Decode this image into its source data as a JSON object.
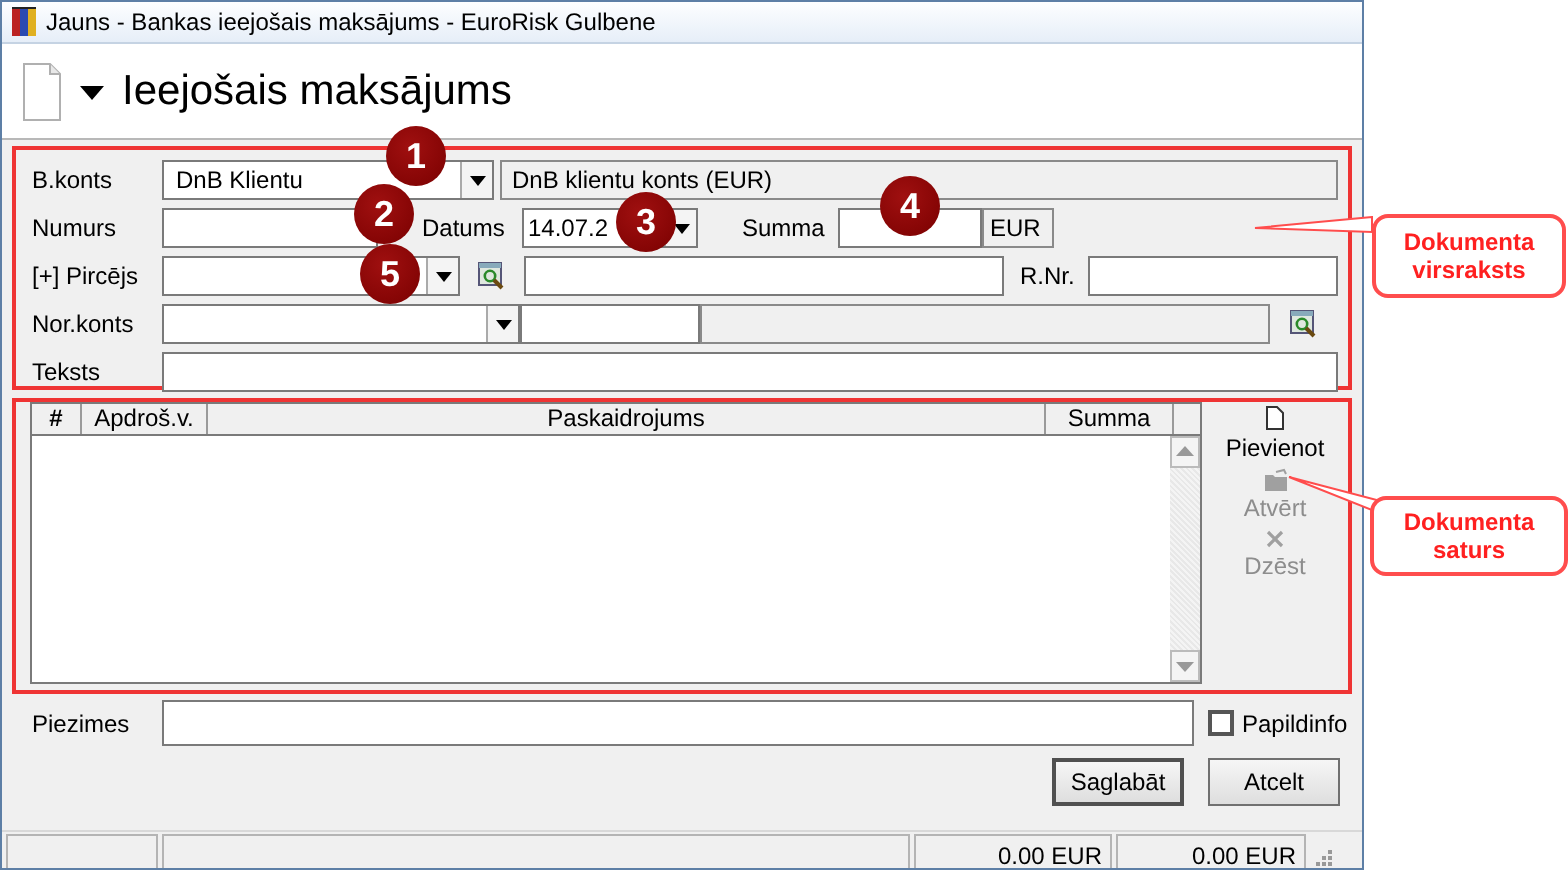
{
  "window": {
    "title": "Jauns - Bankas ieejošais maksājums - EuroRisk Gulbene"
  },
  "header": {
    "title": "Ieejošais maksājums"
  },
  "document_header": {
    "bank_account": {
      "label": "B.konts",
      "value": "DnB Klientu",
      "description": "DnB klientu konts (EUR)"
    },
    "number": {
      "label": "Numurs"
    },
    "date": {
      "label": "Datums",
      "value": "14.07.2"
    },
    "amount": {
      "label": "Summa",
      "currency": "EUR"
    },
    "buyer": {
      "label": "[+] Pircējs"
    },
    "reg_no": {
      "label": "R.Nr."
    },
    "counter_account": {
      "label": "Nor.konts"
    },
    "text": {
      "label": "Teksts"
    }
  },
  "lines_table": {
    "columns": [
      "#",
      "Apdroš.v.",
      "Paskaidrojums",
      "Summa"
    ]
  },
  "side_actions": [
    {
      "kind": "add",
      "label": "Pievienot",
      "disabled": false
    },
    {
      "kind": "open",
      "label": "Atvērt",
      "disabled": true
    },
    {
      "kind": "delete",
      "label": "Dzēst",
      "disabled": true
    }
  ],
  "notes": {
    "label": "Piezimes"
  },
  "extra_info": {
    "label": "Papildinfo",
    "checked": false
  },
  "buttons": [
    "Saglabāt",
    "Atcelt"
  ],
  "status_bar": [
    "0.00 EUR",
    "0.00 EUR"
  ],
  "annotations": {
    "markers": [
      "1",
      "2",
      "3",
      "4",
      "5"
    ],
    "callouts": [
      "Dokumenta virsraksts",
      "Dokumenta saturs"
    ]
  }
}
